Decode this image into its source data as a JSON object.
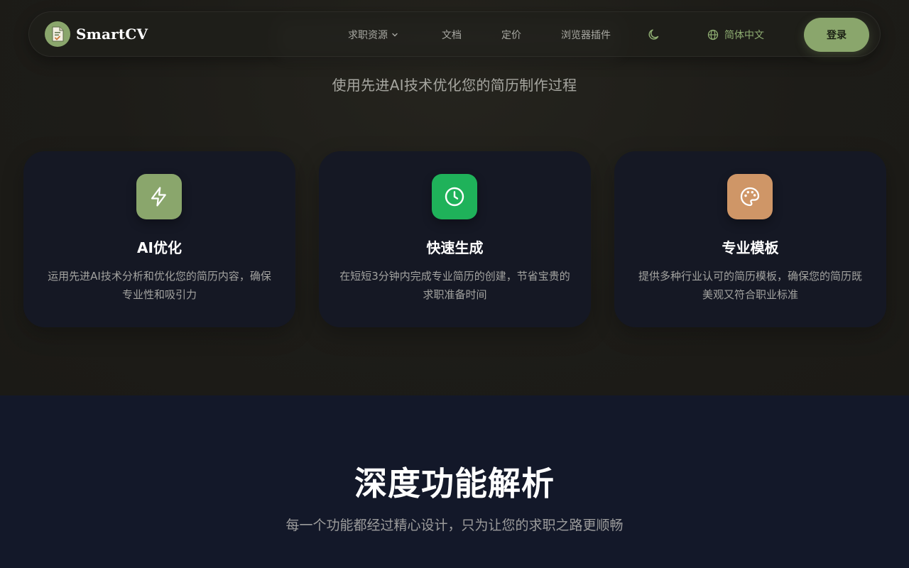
{
  "brand": {
    "name": "SmartCV"
  },
  "nav": {
    "items": [
      {
        "label": "求职资源",
        "has_dropdown": true
      },
      {
        "label": "文档"
      },
      {
        "label": "定价"
      },
      {
        "label": "浏览器插件"
      }
    ],
    "theme_toggle_icon": "moon-icon",
    "language": {
      "label": "简体中文",
      "icon": "globe-icon"
    },
    "login_label": "登录"
  },
  "hero": {
    "subtitle": "使用先进AI技术优化您的简历制作过程"
  },
  "features": [
    {
      "icon": "lightning-icon",
      "icon_bg": "#8aa66c",
      "title": "AI优化",
      "description": "运用先进AI技术分析和优化您的简历内容，确保专业性和吸引力"
    },
    {
      "icon": "clock-icon",
      "icon_bg": "#1fb25a",
      "title": "快速生成",
      "description": "在短短3分钟内完成专业简历的创建，节省宝贵的求职准备时间"
    },
    {
      "icon": "palette-icon",
      "icon_bg": "#cf9667",
      "title": "专业模板",
      "description": "提供多种行业认可的简历模板，确保您的简历既美观又符合职业标准"
    }
  ],
  "deep_section": {
    "title": "深度功能解析",
    "subtitle": "每一个功能都经过精心设计，只为让您的求职之路更顺畅"
  },
  "colors": {
    "accent": "#8aa66c",
    "hero_bg": "#1d1c18",
    "card_bg": "#151824",
    "section_bg": "#131829"
  }
}
